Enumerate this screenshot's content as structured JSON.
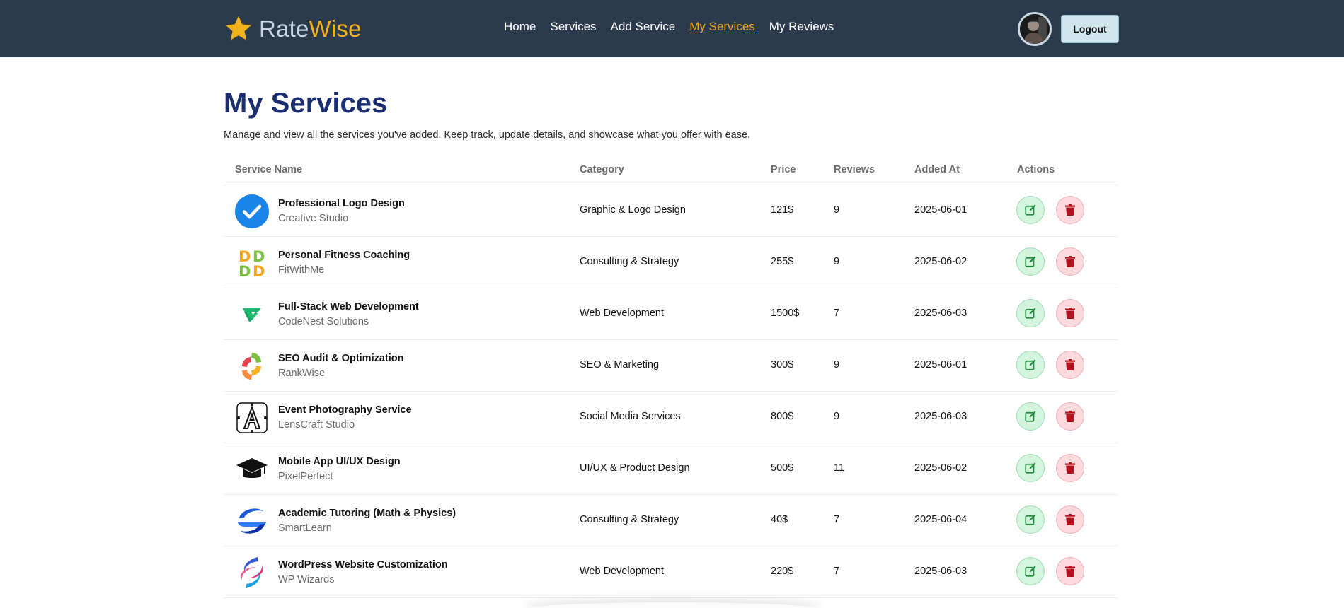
{
  "brand": {
    "part1": "Rate",
    "part2": "Wise",
    "icon": "star-icon"
  },
  "nav": {
    "items": [
      {
        "label": "Home",
        "active": false
      },
      {
        "label": "Services",
        "active": false
      },
      {
        "label": "Add Service",
        "active": false
      },
      {
        "label": "My Services",
        "active": true
      },
      {
        "label": "My Reviews",
        "active": false
      }
    ],
    "logout_label": "Logout"
  },
  "page": {
    "title": "My Services",
    "subtitle": "Manage and view all the services you've added. Keep track, update details, and showcase what you offer with ease."
  },
  "table": {
    "headers": [
      "Service Name",
      "Category",
      "Price",
      "Reviews",
      "Added At",
      "Actions"
    ],
    "rows": [
      {
        "name": "Professional Logo Design",
        "company": "Creative Studio",
        "category": "Graphic & Logo Design",
        "price": "121$",
        "reviews": "9",
        "added": "2025-06-01",
        "logo": "check-badge-icon"
      },
      {
        "name": "Personal Fitness Coaching",
        "company": "FitWithMe",
        "category": "Consulting & Strategy",
        "price": "255$",
        "reviews": "9",
        "added": "2025-06-02",
        "logo": "dd-grid-logo-icon"
      },
      {
        "name": "Full-Stack Web Development",
        "company": "CodeNest Solutions",
        "category": "Web Development",
        "price": "1500$",
        "reviews": "7",
        "added": "2025-06-03",
        "logo": "green-v-logo-icon"
      },
      {
        "name": "SEO Audit & Optimization",
        "company": "RankWise",
        "category": "SEO & Marketing",
        "price": "300$",
        "reviews": "9",
        "added": "2025-06-01",
        "logo": "swirl-logo-icon"
      },
      {
        "name": "Event Photography Service",
        "company": "LensCraft Studio",
        "category": "Social Media Services",
        "price": "800$",
        "reviews": "9",
        "added": "2025-06-03",
        "logo": "letter-a-logo-icon"
      },
      {
        "name": "Mobile App UI/UX Design",
        "company": "PixelPerfect",
        "category": "UI/UX & Product Design",
        "price": "500$",
        "reviews": "11",
        "added": "2025-06-02",
        "logo": "graduation-cap-icon"
      },
      {
        "name": "Academic Tutoring (Math & Physics)",
        "company": "SmartLearn",
        "category": "Consulting & Strategy",
        "price": "40$",
        "reviews": "7",
        "added": "2025-06-04",
        "logo": "blue-ribbon-logo-icon"
      },
      {
        "name": "WordPress Website Customization",
        "company": "WP Wizards",
        "category": "Web Development",
        "price": "220$",
        "reviews": "7",
        "added": "2025-06-03",
        "logo": "twist-logo-icon"
      }
    ],
    "action_icons": {
      "edit": "edit-icon",
      "delete": "trash-icon"
    }
  },
  "colors": {
    "navbar_bg": "#2c3a4e",
    "brand_accent": "#f2b21b",
    "active_link": "#f0a91b",
    "title": "#1a2e70",
    "edit_bg": "#d3f5dd",
    "edit_icon": "#1f8a3a",
    "delete_bg": "#fbd9dc",
    "delete_icon": "#b3131f"
  }
}
